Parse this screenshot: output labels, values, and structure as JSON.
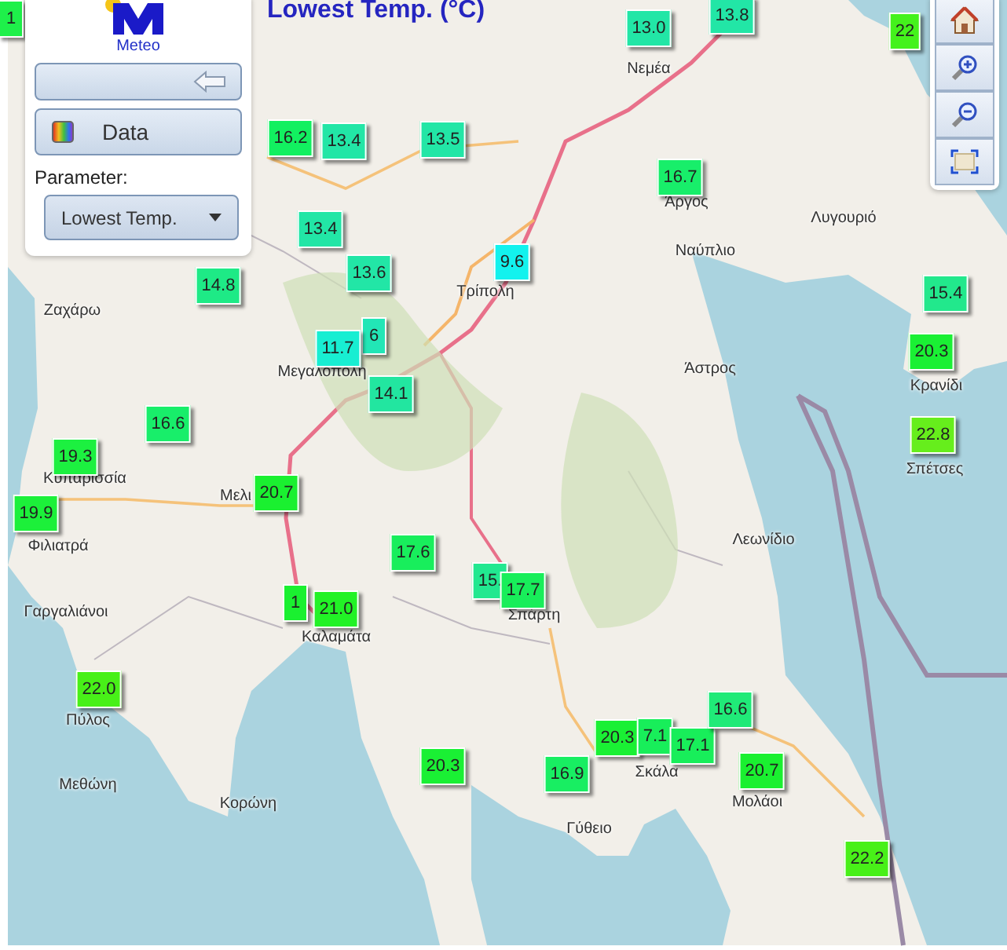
{
  "title": "Lowest Temp. (°C)",
  "panel": {
    "logo_text": "Meteo",
    "data_button": "Data",
    "parameter_label": "Parameter:",
    "parameter_value": "Lowest Temp."
  },
  "toolbar": [
    {
      "kind": "home"
    },
    {
      "kind": "zoom_in"
    },
    {
      "kind": "zoom_out"
    },
    {
      "kind": "extent"
    }
  ],
  "places": [
    "Νεμέα",
    "Άργος",
    "Ναύπλιο",
    "Λυγουριό",
    "Τρίπολη",
    "Ζαχάρω",
    "Μεγαλόπολη",
    "Άστρος",
    "Κρανίδι",
    "Σπέτσες",
    "Κυπαρισσία",
    "Μελι",
    "Φιλιατρά",
    "Λεωνίδιο",
    "Γαργαλιάνοι",
    "Καλαμάτα",
    "Σπάρτη",
    "Πύλος",
    "Σκάλα",
    "Μολάοι",
    "Μεθώνη",
    "Κορώνη",
    "Γύθειο"
  ],
  "stations": [
    {
      "value": "13.0",
      "color": "#22e6a6"
    },
    {
      "value": "13.8",
      "color": "#22e6a6"
    },
    {
      "value": "22",
      "color": "#44f21c"
    },
    {
      "value": "1",
      "color": "#1ef04a"
    },
    {
      "value": "16.2",
      "color": "#12f060"
    },
    {
      "value": "13.4",
      "color": "#22e6a6"
    },
    {
      "value": "13.5",
      "color": "#22e6a6"
    },
    {
      "value": "16.7",
      "color": "#18ee6a"
    },
    {
      "value": "13.4",
      "color": "#22e6a6"
    },
    {
      "value": "13.6",
      "color": "#22e6a6"
    },
    {
      "value": "9.6",
      "color": "#12f2ee"
    },
    {
      "value": "14.8",
      "color": "#1eea86"
    },
    {
      "value": "15.4",
      "color": "#22e88c"
    },
    {
      "value": "6",
      "color": "#22e6b6"
    },
    {
      "value": "11.7",
      "color": "#18eed2"
    },
    {
      "value": "14.1",
      "color": "#22e6a0"
    },
    {
      "value": "20.3",
      "color": "#1af034"
    },
    {
      "value": "16.6",
      "color": "#18ee6a"
    },
    {
      "value": "22.8",
      "color": "#66ee1c"
    },
    {
      "value": "19.3",
      "color": "#1cf040"
    },
    {
      "value": "20.7",
      "color": "#1af030"
    },
    {
      "value": "19.9",
      "color": "#1cf03a"
    },
    {
      "value": "17.6",
      "color": "#18ee5c"
    },
    {
      "value": "15.",
      "color": "#22e890"
    },
    {
      "value": "17.7",
      "color": "#18ee5a"
    },
    {
      "value": "1",
      "color": "#1af030"
    },
    {
      "value": "21.0",
      "color": "#22f226"
    },
    {
      "value": "22.0",
      "color": "#48f018"
    },
    {
      "value": "20.3",
      "color": "#1af034"
    },
    {
      "value": "16.9",
      "color": "#18ee62"
    },
    {
      "value": "20.3",
      "color": "#1af034"
    },
    {
      "value": "7.1",
      "color": "#18ee5a"
    },
    {
      "value": "17.1",
      "color": "#18ee5a"
    },
    {
      "value": "16.6",
      "color": "#20ea78"
    },
    {
      "value": "20.7",
      "color": "#1af030"
    },
    {
      "value": "22.2",
      "color": "#48f018"
    }
  ]
}
